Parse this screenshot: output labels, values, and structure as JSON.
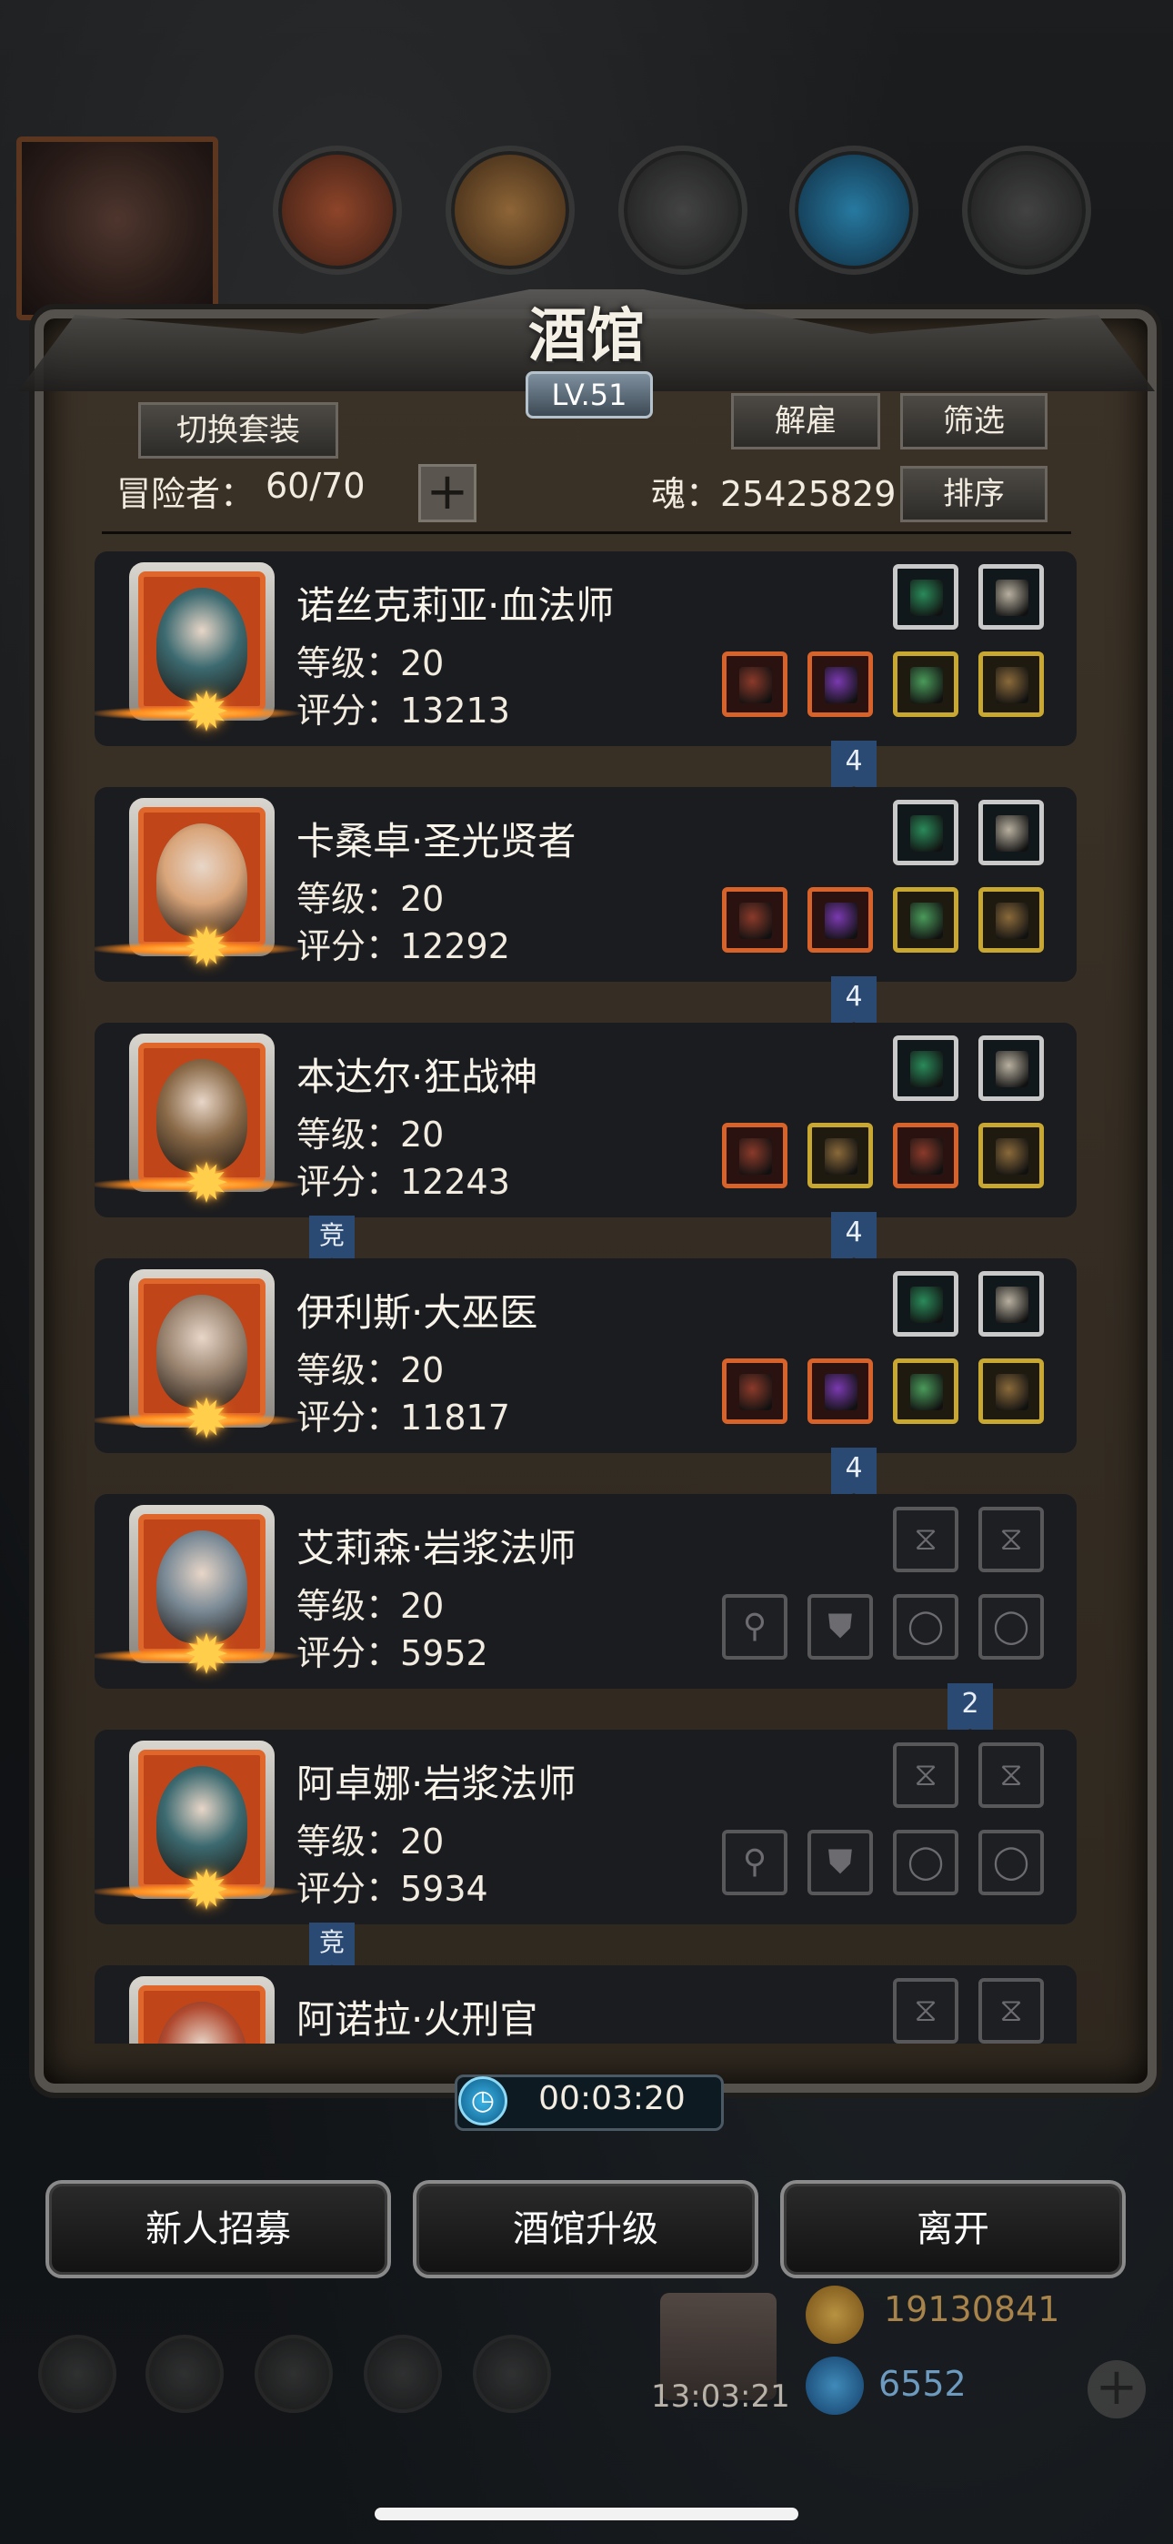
{
  "tavern": {
    "title": "酒馆",
    "level": "LV.51",
    "switch_outfit": "切换套装",
    "dismiss": "解雇",
    "filter": "筛选",
    "sort": "排序",
    "adventurer_label": "冒险者：",
    "adventurer_count": "60/70",
    "add": "+",
    "soul": "魂：25425829"
  },
  "heroes": [
    {
      "name": "诺丝克莉亚·血法师",
      "level": "等级：20",
      "score": "评分：13213",
      "ribbon": "4",
      "jing": "",
      "portrait_color": "#3c6a70",
      "slots_top": [
        "silver",
        "silver"
      ],
      "slots_bottom": [
        "red",
        "red",
        "gold",
        "gold"
      ]
    },
    {
      "name": "卡桑卓·圣光贤者",
      "level": "等级：20",
      "score": "评分：12292",
      "ribbon": "4",
      "jing": "",
      "portrait_color": "#d9a57a",
      "slots_top": [
        "silver",
        "silver"
      ],
      "slots_bottom": [
        "red",
        "red",
        "gold",
        "gold"
      ]
    },
    {
      "name": "本达尔·狂战神",
      "level": "等级：20",
      "score": "评分：12243",
      "ribbon": "4",
      "jing": "竞",
      "portrait_color": "#8a6a48",
      "slots_top": [
        "silver",
        "silver"
      ],
      "slots_bottom": [
        "red",
        "gold",
        "red",
        "gold"
      ]
    },
    {
      "name": "伊利斯·大巫医",
      "level": "等级：20",
      "score": "评分：11817",
      "ribbon": "4",
      "jing": "",
      "portrait_color": "#9a8470",
      "slots_top": [
        "silver",
        "silver"
      ],
      "slots_bottom": [
        "red",
        "red",
        "gold",
        "gold"
      ]
    },
    {
      "name": "艾莉森·岩浆法师",
      "level": "等级：20",
      "score": "评分：5952",
      "ribbon": "2",
      "jing": "",
      "portrait_color": "#7a8a96",
      "slots_top": [
        "empty",
        "empty"
      ],
      "slots_bottom": [
        "empty",
        "empty",
        "empty",
        "empty"
      ]
    },
    {
      "name": "阿卓娜·岩浆法师",
      "level": "等级：20",
      "score": "评分：5934",
      "ribbon": "",
      "jing": "竞",
      "portrait_color": "#3c6a70",
      "slots_top": [
        "empty",
        "empty"
      ],
      "slots_bottom": [
        "empty",
        "empty",
        "empty",
        "empty"
      ]
    },
    {
      "name": "阿诺拉·火刑官",
      "level": "",
      "score": "",
      "ribbon": "",
      "jing": "",
      "portrait_color": "#b04a30",
      "slots_top": [
        "empty",
        "empty"
      ],
      "slots_bottom": []
    }
  ],
  "timer": "00:03:20",
  "buttons": {
    "recruit": "新人招募",
    "upgrade": "酒馆升级",
    "leave": "离开"
  },
  "hud": {
    "gift_time": "13:03:21",
    "gold": "19130841",
    "gems": "6552",
    "plus": "+"
  },
  "colors": {
    "ribbon": "#2b4a73",
    "rare_frame": "#d7622a",
    "epic_frame": "#c9a832",
    "panel": "#3b3227"
  }
}
